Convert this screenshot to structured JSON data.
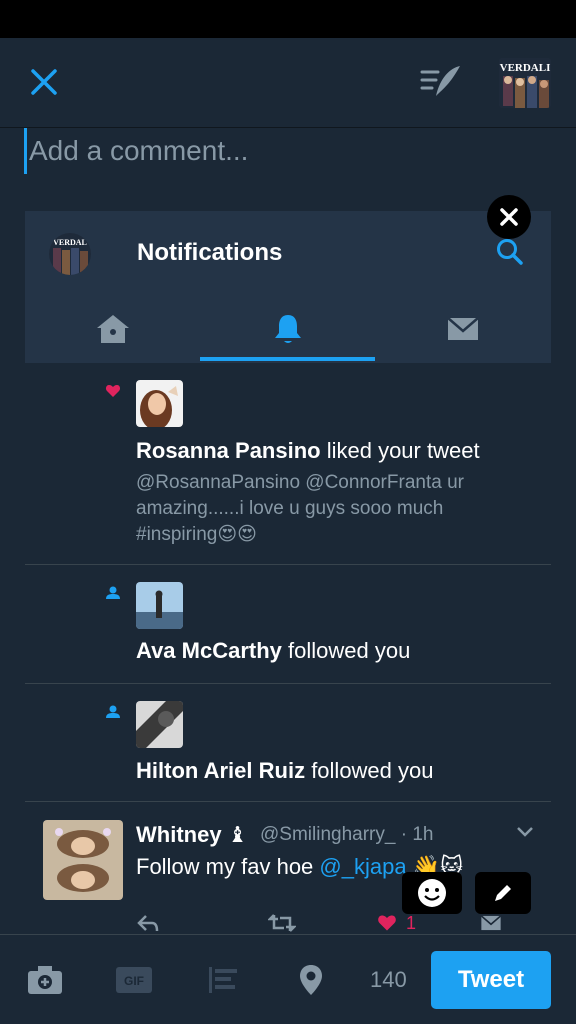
{
  "compose": {
    "comment_placeholder": "Add a comment...",
    "char_count": "140",
    "tweet_label": "Tweet"
  },
  "card": {
    "title": "Notifications",
    "account_avatar_text": "VERDALI",
    "card_avatar_text": "VERDAL"
  },
  "notifications": [
    {
      "type": "like",
      "name": "Rosanna Pansino",
      "action": " liked your tweet",
      "body": "@RosannaPansino @ConnorFranta  ur amazing......i love u guys sooo much #inspiring😍😍"
    },
    {
      "type": "follow",
      "name": "Ava McCarthy",
      "action": " followed you"
    },
    {
      "type": "follow",
      "name": "Hilton Ariel Ruiz",
      "action": " followed you"
    }
  ],
  "tweet": {
    "name": "Whitney ♝",
    "handle": "@Smilingharry_ · 1h",
    "text": "Follow my fav hoe ",
    "mention": "@_kjapa",
    "emoji": "👋🐱",
    "like_count": "1"
  },
  "colors": {
    "background": "#1b2836",
    "card": "#243447",
    "accent": "#1da1f2",
    "muted": "#8899a6",
    "like": "#e0245e"
  }
}
